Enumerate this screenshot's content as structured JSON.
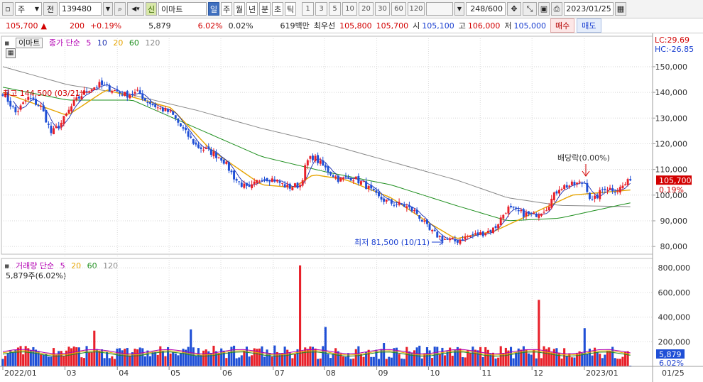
{
  "toolbar": {
    "type_label": "주",
    "prefix_label": "전",
    "stock_code": "139480",
    "market_badge": "신",
    "stock_name": "이마트",
    "periods": [
      "일",
      "주",
      "월",
      "년",
      "분",
      "초",
      "틱"
    ],
    "active_period": "일",
    "intervals": [
      "1",
      "3",
      "5",
      "10",
      "20",
      "30",
      "60",
      "120"
    ],
    "count_display": "248/600",
    "date": "2023/01/25"
  },
  "quote": {
    "price": "105,700",
    "change_arrow": "▲",
    "change": "200",
    "change_pct": "+0.19%",
    "volume": "5,879",
    "volume_pct": "6.02%",
    "turnover_pct": "0.02%",
    "amount": "619백만",
    "best_label": "최우선",
    "best_ask": "105,800",
    "best_bid": "105,700",
    "open_label": "시",
    "open": "105,100",
    "high_label": "고",
    "high": "106,000",
    "low_label": "저",
    "low": "105,000",
    "buy_label": "매수",
    "sell_label": "매도"
  },
  "price_panel": {
    "stock_tab": "이마트",
    "legend_prefix": "종가 단순",
    "ma_periods": [
      "5",
      "10",
      "20",
      "60",
      "120"
    ],
    "ma_colors": [
      "#1b2fb0",
      "#1b2fb0",
      "#e6a400",
      "#1e8f1e",
      "#888888"
    ],
    "lc_label": "LC:29.69",
    "hc_label": "HC:-26.85",
    "last_price": "105,700",
    "last_pct": "0.19%",
    "high_annotation": "최고 144,500 (03/21)",
    "low_annotation": "최저 81,500 (10/11)",
    "dividend_annotation": "배당락(0.00%)"
  },
  "volume_panel": {
    "legend_prefix": "거래량 단순",
    "ma_periods": [
      "5",
      "20",
      "60",
      "120"
    ],
    "current": "5,879주(6.02%)",
    "last_volume": "5,879",
    "last_pct": "6.02%"
  },
  "colors": {
    "up": "#e8202a",
    "down": "#1f4fd6",
    "ma20": "#e6a400",
    "ma60": "#1e8f1e",
    "ma120": "#888888",
    "ma5": "#1b2fb0"
  },
  "chart_data": {
    "type": "candlestick",
    "title": "이마트",
    "y_axis_price": {
      "ticks": [
        80000,
        90000,
        100000,
        110000,
        120000,
        130000,
        140000,
        150000
      ],
      "range": [
        77000,
        158000
      ]
    },
    "y_axis_volume": {
      "ticks": [
        200000,
        400000,
        600000,
        800000
      ],
      "range": [
        0,
        830000
      ]
    },
    "x_axis_labels": [
      "2022/01",
      "03",
      "04",
      "05",
      "06",
      "07",
      "08",
      "09",
      "10",
      "11",
      "12",
      "2023/01",
      "01/25"
    ],
    "x_axis_fractions": [
      0.0,
      0.096,
      0.177,
      0.257,
      0.337,
      0.418,
      0.497,
      0.578,
      0.658,
      0.738,
      0.818,
      0.899
    ],
    "close_path": [
      [
        0,
        140000
      ],
      [
        0.02,
        132000
      ],
      [
        0.04,
        138000
      ],
      [
        0.06,
        134000
      ],
      [
        0.075,
        124000
      ],
      [
        0.09,
        128000
      ],
      [
        0.11,
        136000
      ],
      [
        0.13,
        141000
      ],
      [
        0.15,
        143000
      ],
      [
        0.17,
        141000
      ],
      [
        0.19,
        139000
      ],
      [
        0.21,
        140000
      ],
      [
        0.22,
        137000
      ],
      [
        0.24,
        134000
      ],
      [
        0.26,
        132000
      ],
      [
        0.28,
        125000
      ],
      [
        0.3,
        119000
      ],
      [
        0.32,
        117000
      ],
      [
        0.34,
        114000
      ],
      [
        0.36,
        106000
      ],
      [
        0.38,
        102000
      ],
      [
        0.4,
        107000
      ],
      [
        0.42,
        106000
      ],
      [
        0.44,
        103000
      ],
      [
        0.46,
        104000
      ],
      [
        0.47,
        113000
      ],
      [
        0.48,
        115000
      ],
      [
        0.5,
        110000
      ],
      [
        0.52,
        106000
      ],
      [
        0.54,
        107000
      ],
      [
        0.56,
        104000
      ],
      [
        0.58,
        99000
      ],
      [
        0.6,
        97000
      ],
      [
        0.62,
        96000
      ],
      [
        0.64,
        93000
      ],
      [
        0.66,
        86000
      ],
      [
        0.68,
        83000
      ],
      [
        0.7,
        82000
      ],
      [
        0.72,
        84000
      ],
      [
        0.74,
        85000
      ],
      [
        0.76,
        87000
      ],
      [
        0.78,
        95000
      ],
      [
        0.8,
        93000
      ],
      [
        0.82,
        92000
      ],
      [
        0.84,
        95000
      ],
      [
        0.86,
        103000
      ],
      [
        0.88,
        104000
      ],
      [
        0.9,
        105000
      ],
      [
        0.91,
        97000
      ],
      [
        0.93,
        103000
      ],
      [
        0.95,
        102000
      ],
      [
        0.97,
        105700
      ]
    ],
    "ma20_path": [
      [
        0,
        140000
      ],
      [
        0.1,
        131000
      ],
      [
        0.16,
        141000
      ],
      [
        0.26,
        134000
      ],
      [
        0.32,
        118000
      ],
      [
        0.4,
        104000
      ],
      [
        0.45,
        103000
      ],
      [
        0.48,
        108000
      ],
      [
        0.53,
        106000
      ],
      [
        0.6,
        99000
      ],
      [
        0.66,
        89000
      ],
      [
        0.7,
        83000
      ],
      [
        0.76,
        86000
      ],
      [
        0.82,
        93000
      ],
      [
        0.88,
        100000
      ],
      [
        0.97,
        102000
      ]
    ],
    "ma60_path": [
      [
        0,
        142000
      ],
      [
        0.1,
        137000
      ],
      [
        0.2,
        137000
      ],
      [
        0.3,
        126000
      ],
      [
        0.4,
        115000
      ],
      [
        0.5,
        109000
      ],
      [
        0.6,
        104000
      ],
      [
        0.7,
        96000
      ],
      [
        0.78,
        90000
      ],
      [
        0.86,
        91000
      ],
      [
        0.97,
        97000
      ]
    ],
    "ma120_path": [
      [
        0,
        150000
      ],
      [
        0.1,
        143000
      ],
      [
        0.2,
        139000
      ],
      [
        0.3,
        133000
      ],
      [
        0.4,
        126000
      ],
      [
        0.5,
        120000
      ],
      [
        0.6,
        113000
      ],
      [
        0.7,
        106000
      ],
      [
        0.78,
        99000
      ],
      [
        0.86,
        96000
      ],
      [
        0.97,
        95500
      ]
    ],
    "volume_spikes": [
      [
        0.46,
        820000
      ],
      [
        0.5,
        320000
      ],
      [
        0.83,
        540000
      ],
      [
        0.29,
        300000
      ],
      [
        0.14,
        290000
      ],
      [
        0.9,
        310000
      ],
      [
        0.59,
        190000
      ]
    ]
  }
}
